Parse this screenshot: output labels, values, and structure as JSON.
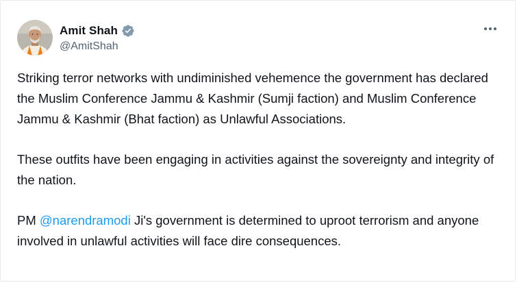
{
  "author": {
    "display_name": "Amit Shah",
    "handle": "@AmitShah",
    "verified_icon": "verified-badge-icon",
    "avatar": "avatar-photo"
  },
  "menu": {
    "icon": "more-options-icon"
  },
  "tweet": {
    "paragraphs": [
      "Striking terror networks with undiminished vehemence the government has declared the Muslim Conference Jammu & Kashmir (Sumji faction) and Muslim Conference Jammu & Kashmir (Bhat faction) as Unlawful Associations.",
      "These outfits have been engaging in activities against the sovereignty and integrity of the nation."
    ],
    "last_paragraph": {
      "prefix": "PM ",
      "mention": "@narendramodi",
      "suffix": " Ji's government is determined to uproot terrorism and anyone involved in unlawful activities will face dire consequences."
    }
  },
  "colors": {
    "text": "#0f1419",
    "secondary": "#536471",
    "link": "#1d9bf0",
    "verified": "#829aab"
  }
}
